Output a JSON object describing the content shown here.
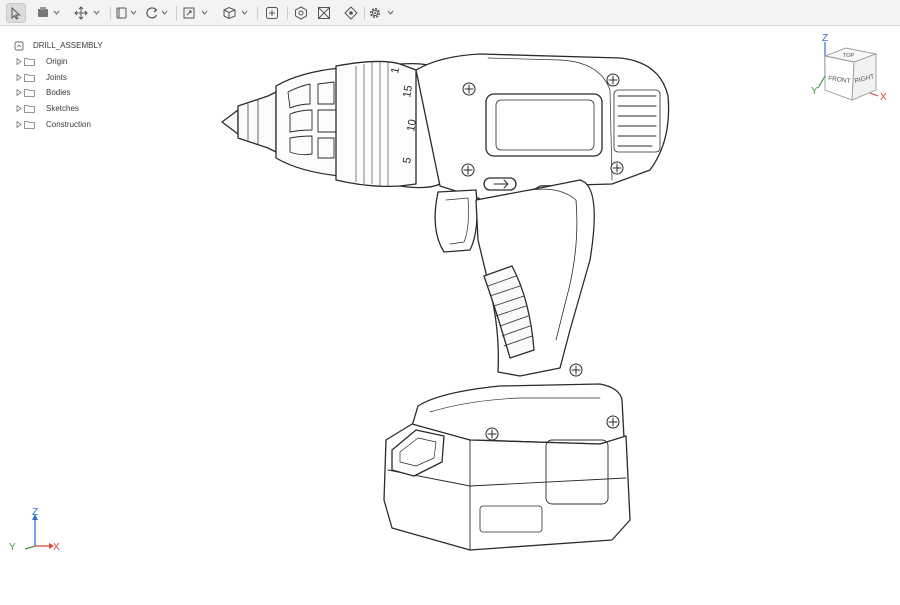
{
  "toolbar": {
    "tools": [
      {
        "name": "select",
        "icon": "cursor-icon",
        "has_dropdown": false,
        "active": true
      },
      {
        "name": "component",
        "icon": "component-icon",
        "has_dropdown": true
      },
      {
        "name": "move",
        "icon": "move-icon",
        "has_dropdown": true
      },
      {
        "name": "display",
        "icon": "display-mode-icon",
        "has_dropdown": true
      },
      {
        "name": "orbit",
        "icon": "orbit-icon",
        "has_dropdown": true
      },
      {
        "name": "zoom-fit",
        "icon": "zoom-fit-icon",
        "has_dropdown": true
      },
      {
        "name": "view",
        "icon": "view-cube-icon",
        "has_dropdown": true
      },
      {
        "name": "section",
        "icon": "section-icon",
        "has_dropdown": false
      },
      {
        "name": "render",
        "icon": "render-icon",
        "has_dropdown": false
      },
      {
        "name": "wireframe",
        "icon": "wireframe-icon",
        "has_dropdown": false
      },
      {
        "name": "navigate",
        "icon": "navigate-icon",
        "has_dropdown": false
      },
      {
        "name": "settings",
        "icon": "gear-icon",
        "has_dropdown": true
      }
    ]
  },
  "browser": {
    "root": {
      "label": "DRILL_ASSEMBLY",
      "icon": "document-icon"
    },
    "items": [
      {
        "label": "Origin",
        "icon": "folder-icon"
      },
      {
        "label": "Joints",
        "icon": "folder-icon"
      },
      {
        "label": "Bodies",
        "icon": "folder-icon"
      },
      {
        "label": "Sketches",
        "icon": "folder-icon"
      },
      {
        "label": "Construction",
        "icon": "folder-icon"
      }
    ]
  },
  "model": {
    "chuck_scale": [
      "1",
      "15",
      "10",
      "5"
    ]
  },
  "viewcube": {
    "top": "TOP",
    "front": "FRONT",
    "right": "RIGHT",
    "axis_x": "X",
    "axis_y": "Y",
    "axis_z": "Z"
  },
  "triad": {
    "x": "X",
    "y": "Y",
    "z": "Z"
  },
  "colors": {
    "axis_x": "#d9463b",
    "axis_y": "#3f9b45",
    "axis_z": "#2d6fd6",
    "line": "#2b2b2b"
  }
}
